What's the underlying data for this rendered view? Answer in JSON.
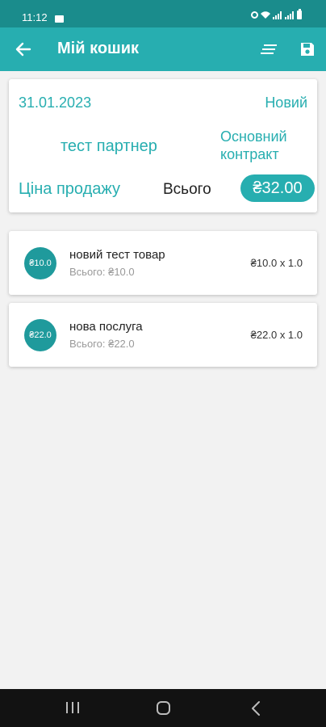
{
  "status_bar": {
    "time": "11:12",
    "icons": [
      "photo-icon",
      "alarm-icon",
      "wifi-icon",
      "signal-icon",
      "signal-icon",
      "battery-icon"
    ]
  },
  "app_bar": {
    "title": "Мій кошик",
    "back_icon": "arrow-left-icon",
    "sort_icon": "sort-lines-icon",
    "save_icon": "save-icon"
  },
  "summary": {
    "date": "31.01.2023",
    "status": "Новий",
    "partner": "тест партнер",
    "contract": "Основний контракт",
    "price_type": "Ціна продажу",
    "total_label": "Всього",
    "total_value": "₴32.00"
  },
  "items": [
    {
      "avatar": "₴10.0",
      "name": "новий тест товар",
      "subtotal": "Всього: ₴10.0",
      "qty": "₴10.0 x 1.0"
    },
    {
      "avatar": "₴22.0",
      "name": "нова послуга",
      "subtotal": "Всього: ₴22.0",
      "qty": "₴22.0 x 1.0"
    }
  ],
  "nav": {
    "recent_icon": "recent-apps-icon",
    "home_icon": "home-icon",
    "back_icon": "nav-back-icon"
  },
  "colors": {
    "status_bar": "#1a8c8c",
    "app_bar": "#27aeb0",
    "accent": "#27aeb0",
    "avatar": "#1f9a9c"
  }
}
